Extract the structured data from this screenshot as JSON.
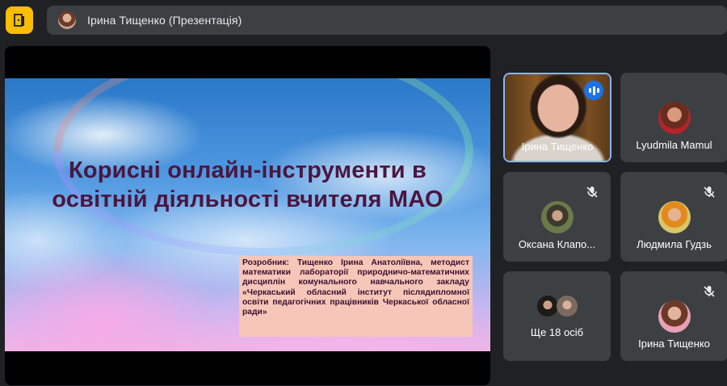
{
  "header": {
    "presentation_title": "Ірина Тищенко (Презентація)",
    "exit_icon": "door-exit-icon",
    "accent_color": "#fbbc04"
  },
  "slide": {
    "title_line1": "Корисні онлайн-інструменти в",
    "title_line2": "освітній діяльності вчителя МАО",
    "author_text": "Розробник: Тищенко Ірина Анатоліївна, методист математики лабораторії природничо-математичних дисциплін комунального навчального закладу «Черкаський обласний інститут післядипломної освіти педагогічних працівників Черкаської обласної ради»"
  },
  "participants": [
    {
      "name": "Ірина Тищенко",
      "state": "speaking",
      "icon": "speaking-indicator-icon"
    },
    {
      "name": "Lyudmila Mamul",
      "state": "avatar"
    },
    {
      "name": "Оксана Клапо...",
      "state": "muted",
      "icon": "mic-off-icon"
    },
    {
      "name": "Людмила Гудзь",
      "state": "muted",
      "icon": "mic-off-icon"
    },
    {
      "name": "Ще 18 осіб",
      "state": "more"
    },
    {
      "name": "Ірина Тищенко",
      "state": "muted",
      "icon": "mic-off-icon"
    }
  ]
}
